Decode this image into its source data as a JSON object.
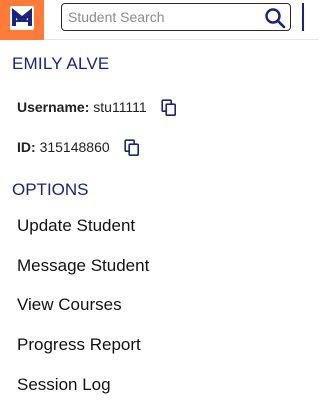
{
  "header": {
    "logo_icon": "graduation-cap-logo-icon",
    "logo_bg_color": "#ff7b3a",
    "search_placeholder": "Student Search",
    "search_icon": "search-icon"
  },
  "student": {
    "name": "EMILY ALVE",
    "username_label": "Username:",
    "username_value": "stu11111",
    "id_label": "ID:",
    "id_value": "315148860",
    "copy_icon": "copy-icon",
    "name_color": "#1a237e"
  },
  "options": {
    "title": "OPTIONS",
    "items": [
      {
        "label": "Update Student"
      },
      {
        "label": "Message Student"
      },
      {
        "label": "View Courses"
      },
      {
        "label": "Progress Report"
      },
      {
        "label": "Session Log"
      }
    ]
  }
}
